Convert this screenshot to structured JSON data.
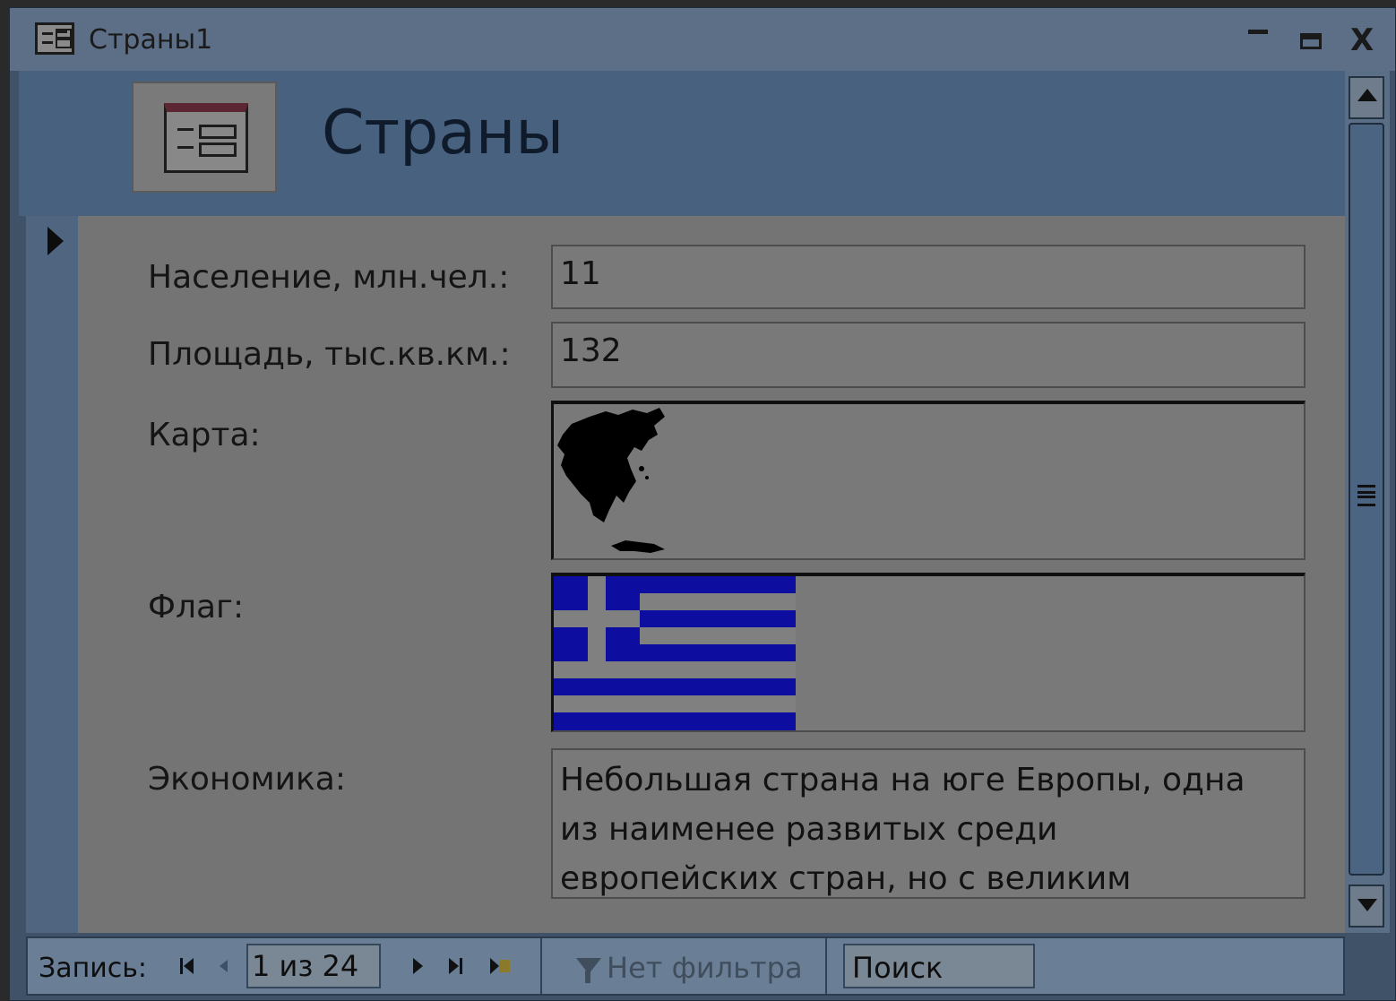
{
  "window": {
    "title": "Страны1",
    "minimize_icon": "minimize-icon",
    "maximize_icon": "maximize-icon",
    "close_symbol": "X"
  },
  "form": {
    "header_title": "Страны",
    "header_icon": "form-icon"
  },
  "fields": {
    "population_label": "Население, млн.чел.:",
    "population_value": "11",
    "area_label": "Площадь, тыс.кв.км.:",
    "area_value": "132",
    "map_label": "Карта:",
    "flag_label": "Флаг:",
    "economy_label": "Экономика:",
    "economy_value": "Небольшая страна на юге Европы, одна\n из наименее развитых среди\nевропейских стран, но с великим"
  },
  "navigation": {
    "record_label": "Запись:",
    "record_position": "1 из 24",
    "filter_label": "Нет фильтра",
    "search_label": "Поиск"
  },
  "colors": {
    "flag_blue": "#0d0da0",
    "flag_white": "#808080",
    "map_fill": "#000000"
  }
}
